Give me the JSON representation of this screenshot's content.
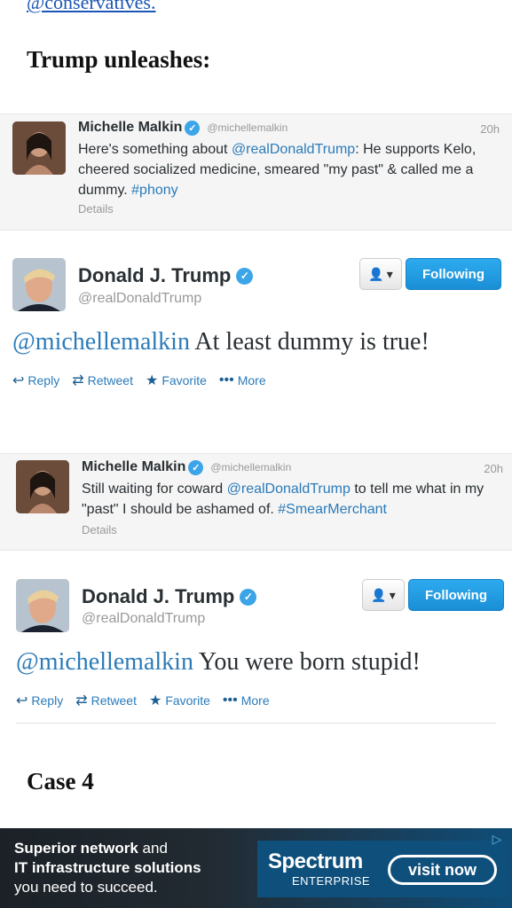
{
  "top_link": "@conservatives.",
  "headings": {
    "first": "Trump unleashes:",
    "second": "Case 4"
  },
  "tweets": [
    {
      "reply": {
        "name": "Michelle Malkin",
        "handle": "@michellemalkin",
        "time": "20h",
        "text_parts": [
          "Here's something about ",
          "@realDonaldTrump",
          ": He supports Kelo, cheered socialized medicine, smeared \"my past\" & called me a dummy. ",
          "#phony"
        ],
        "details": "Details"
      },
      "main": {
        "name": "Donald J. Trump",
        "handle": "@realDonaldTrump",
        "menu_label": "▾",
        "follow_label": "Following",
        "mention": "@michellemalkin",
        "text": " At least dummy is true!"
      }
    },
    {
      "reply": {
        "name": "Michelle Malkin",
        "handle": "@michellemalkin",
        "time": "20h",
        "text_parts": [
          "Still waiting for coward ",
          "@realDonaldTrump",
          " to tell me what in my \"past\" I should be ashamed of. ",
          "#SmearMerchant"
        ],
        "details": "Details"
      },
      "main": {
        "name": "Donald J. Trump",
        "handle": "@realDonaldTrump",
        "menu_label": "▾",
        "follow_label": "Following",
        "mention": "@michellemalkin",
        "text": " You were born stupid!"
      }
    }
  ],
  "actions": {
    "reply": "Reply",
    "retweet": "Retweet",
    "favorite": "Favorite",
    "more": "More"
  },
  "ad": {
    "line1_bold": "Superior network",
    "line1_rest": " and",
    "line2_bold": "IT infrastructure solutions",
    "line3": "you need to succeed.",
    "brand": "Spectrum",
    "brand_sub": "ENTERPRISE",
    "cta": "visit now"
  },
  "colors": {
    "link_blue": "#2b7bb9",
    "follow_blue": "#1a8fd6",
    "verified_blue": "#3ba5e8"
  }
}
